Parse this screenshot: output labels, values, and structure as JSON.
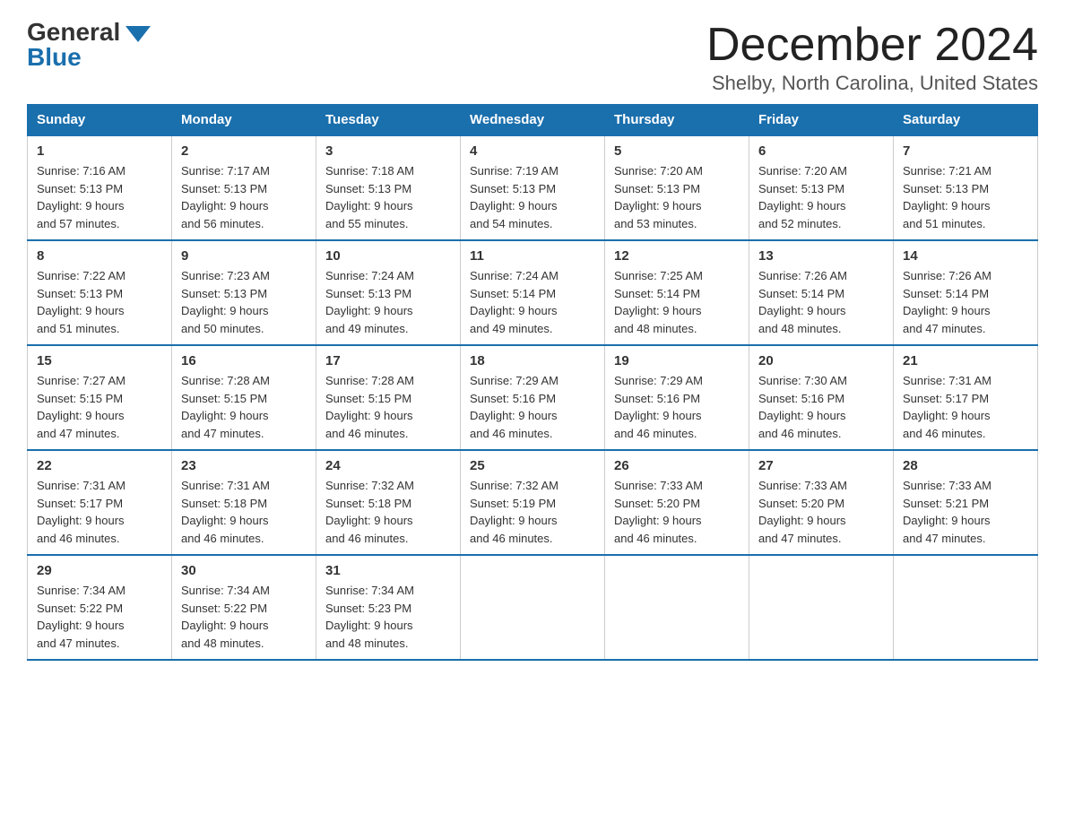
{
  "logo": {
    "general": "General",
    "blue": "Blue"
  },
  "header": {
    "month": "December 2024",
    "location": "Shelby, North Carolina, United States"
  },
  "days_of_week": [
    "Sunday",
    "Monday",
    "Tuesday",
    "Wednesday",
    "Thursday",
    "Friday",
    "Saturday"
  ],
  "weeks": [
    [
      {
        "day": "1",
        "sunrise": "7:16 AM",
        "sunset": "5:13 PM",
        "daylight": "9 hours and 57 minutes."
      },
      {
        "day": "2",
        "sunrise": "7:17 AM",
        "sunset": "5:13 PM",
        "daylight": "9 hours and 56 minutes."
      },
      {
        "day": "3",
        "sunrise": "7:18 AM",
        "sunset": "5:13 PM",
        "daylight": "9 hours and 55 minutes."
      },
      {
        "day": "4",
        "sunrise": "7:19 AM",
        "sunset": "5:13 PM",
        "daylight": "9 hours and 54 minutes."
      },
      {
        "day": "5",
        "sunrise": "7:20 AM",
        "sunset": "5:13 PM",
        "daylight": "9 hours and 53 minutes."
      },
      {
        "day": "6",
        "sunrise": "7:20 AM",
        "sunset": "5:13 PM",
        "daylight": "9 hours and 52 minutes."
      },
      {
        "day": "7",
        "sunrise": "7:21 AM",
        "sunset": "5:13 PM",
        "daylight": "9 hours and 51 minutes."
      }
    ],
    [
      {
        "day": "8",
        "sunrise": "7:22 AM",
        "sunset": "5:13 PM",
        "daylight": "9 hours and 51 minutes."
      },
      {
        "day": "9",
        "sunrise": "7:23 AM",
        "sunset": "5:13 PM",
        "daylight": "9 hours and 50 minutes."
      },
      {
        "day": "10",
        "sunrise": "7:24 AM",
        "sunset": "5:13 PM",
        "daylight": "9 hours and 49 minutes."
      },
      {
        "day": "11",
        "sunrise": "7:24 AM",
        "sunset": "5:14 PM",
        "daylight": "9 hours and 49 minutes."
      },
      {
        "day": "12",
        "sunrise": "7:25 AM",
        "sunset": "5:14 PM",
        "daylight": "9 hours and 48 minutes."
      },
      {
        "day": "13",
        "sunrise": "7:26 AM",
        "sunset": "5:14 PM",
        "daylight": "9 hours and 48 minutes."
      },
      {
        "day": "14",
        "sunrise": "7:26 AM",
        "sunset": "5:14 PM",
        "daylight": "9 hours and 47 minutes."
      }
    ],
    [
      {
        "day": "15",
        "sunrise": "7:27 AM",
        "sunset": "5:15 PM",
        "daylight": "9 hours and 47 minutes."
      },
      {
        "day": "16",
        "sunrise": "7:28 AM",
        "sunset": "5:15 PM",
        "daylight": "9 hours and 47 minutes."
      },
      {
        "day": "17",
        "sunrise": "7:28 AM",
        "sunset": "5:15 PM",
        "daylight": "9 hours and 46 minutes."
      },
      {
        "day": "18",
        "sunrise": "7:29 AM",
        "sunset": "5:16 PM",
        "daylight": "9 hours and 46 minutes."
      },
      {
        "day": "19",
        "sunrise": "7:29 AM",
        "sunset": "5:16 PM",
        "daylight": "9 hours and 46 minutes."
      },
      {
        "day": "20",
        "sunrise": "7:30 AM",
        "sunset": "5:16 PM",
        "daylight": "9 hours and 46 minutes."
      },
      {
        "day": "21",
        "sunrise": "7:31 AM",
        "sunset": "5:17 PM",
        "daylight": "9 hours and 46 minutes."
      }
    ],
    [
      {
        "day": "22",
        "sunrise": "7:31 AM",
        "sunset": "5:17 PM",
        "daylight": "9 hours and 46 minutes."
      },
      {
        "day": "23",
        "sunrise": "7:31 AM",
        "sunset": "5:18 PM",
        "daylight": "9 hours and 46 minutes."
      },
      {
        "day": "24",
        "sunrise": "7:32 AM",
        "sunset": "5:18 PM",
        "daylight": "9 hours and 46 minutes."
      },
      {
        "day": "25",
        "sunrise": "7:32 AM",
        "sunset": "5:19 PM",
        "daylight": "9 hours and 46 minutes."
      },
      {
        "day": "26",
        "sunrise": "7:33 AM",
        "sunset": "5:20 PM",
        "daylight": "9 hours and 46 minutes."
      },
      {
        "day": "27",
        "sunrise": "7:33 AM",
        "sunset": "5:20 PM",
        "daylight": "9 hours and 47 minutes."
      },
      {
        "day": "28",
        "sunrise": "7:33 AM",
        "sunset": "5:21 PM",
        "daylight": "9 hours and 47 minutes."
      }
    ],
    [
      {
        "day": "29",
        "sunrise": "7:34 AM",
        "sunset": "5:22 PM",
        "daylight": "9 hours and 47 minutes."
      },
      {
        "day": "30",
        "sunrise": "7:34 AM",
        "sunset": "5:22 PM",
        "daylight": "9 hours and 48 minutes."
      },
      {
        "day": "31",
        "sunrise": "7:34 AM",
        "sunset": "5:23 PM",
        "daylight": "9 hours and 48 minutes."
      },
      null,
      null,
      null,
      null
    ]
  ],
  "labels": {
    "sunrise": "Sunrise:",
    "sunset": "Sunset:",
    "daylight": "Daylight:"
  }
}
